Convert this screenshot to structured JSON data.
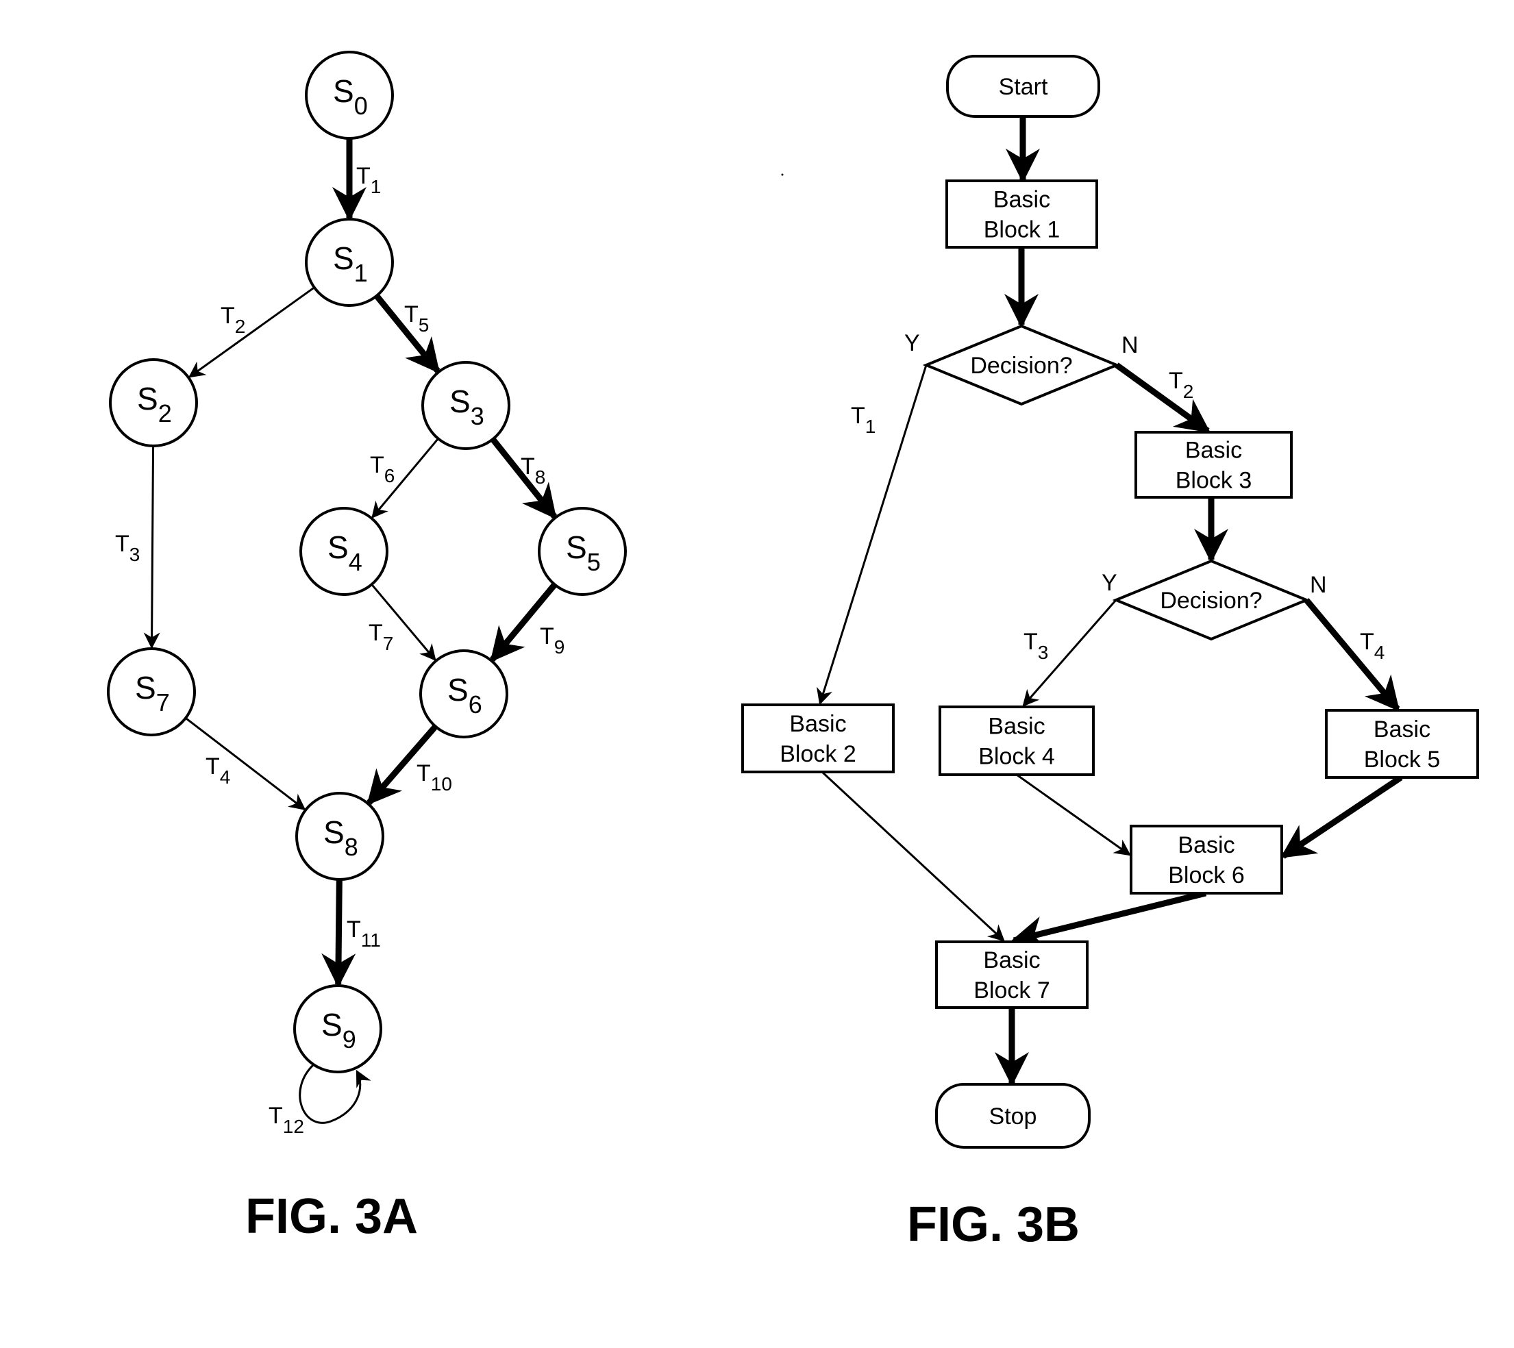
{
  "figures": [
    {
      "caption": "FIG. 3A",
      "type": "state-transition-graph",
      "states": [
        {
          "id": "S0",
          "letter": "S",
          "index": "0"
        },
        {
          "id": "S1",
          "letter": "S",
          "index": "1"
        },
        {
          "id": "S2",
          "letter": "S",
          "index": "2"
        },
        {
          "id": "S3",
          "letter": "S",
          "index": "3"
        },
        {
          "id": "S4",
          "letter": "S",
          "index": "4"
        },
        {
          "id": "S5",
          "letter": "S",
          "index": "5"
        },
        {
          "id": "S6",
          "letter": "S",
          "index": "6"
        },
        {
          "id": "S7",
          "letter": "S",
          "index": "7"
        },
        {
          "id": "S8",
          "letter": "S",
          "index": "8"
        },
        {
          "id": "S9",
          "letter": "S",
          "index": "9"
        }
      ],
      "transitions": [
        {
          "id": "T1",
          "letter": "T",
          "index": "1",
          "from": "S0",
          "to": "S1",
          "emphasis": "thick"
        },
        {
          "id": "T2",
          "letter": "T",
          "index": "2",
          "from": "S1",
          "to": "S2",
          "emphasis": "thin"
        },
        {
          "id": "T5",
          "letter": "T",
          "index": "5",
          "from": "S1",
          "to": "S3",
          "emphasis": "thick"
        },
        {
          "id": "T3",
          "letter": "T",
          "index": "3",
          "from": "S2",
          "to": "S7",
          "emphasis": "thin"
        },
        {
          "id": "T6",
          "letter": "T",
          "index": "6",
          "from": "S3",
          "to": "S4",
          "emphasis": "thin"
        },
        {
          "id": "T8",
          "letter": "T",
          "index": "8",
          "from": "S3",
          "to": "S5",
          "emphasis": "thick"
        },
        {
          "id": "T7",
          "letter": "T",
          "index": "7",
          "from": "S4",
          "to": "S6",
          "emphasis": "thin"
        },
        {
          "id": "T9",
          "letter": "T",
          "index": "9",
          "from": "S5",
          "to": "S6",
          "emphasis": "thick"
        },
        {
          "id": "T4",
          "letter": "T",
          "index": "4",
          "from": "S7",
          "to": "S8",
          "emphasis": "thin"
        },
        {
          "id": "T10",
          "letter": "T",
          "index": "10",
          "from": "S6",
          "to": "S8",
          "emphasis": "thick"
        },
        {
          "id": "T11",
          "letter": "T",
          "index": "11",
          "from": "S8",
          "to": "S9",
          "emphasis": "thick"
        },
        {
          "id": "T12",
          "letter": "T",
          "index": "12",
          "from": "S9",
          "to": "S9",
          "emphasis": "thin"
        }
      ]
    },
    {
      "caption": "FIG. 3B",
      "type": "flowchart",
      "nodes": [
        {
          "id": "start",
          "shape": "terminal",
          "lines": [
            "Start"
          ]
        },
        {
          "id": "bb1",
          "shape": "process",
          "lines": [
            "Basic",
            "Block 1"
          ]
        },
        {
          "id": "d1",
          "shape": "decision",
          "lines": [
            "Decision?"
          ]
        },
        {
          "id": "bb2",
          "shape": "process",
          "lines": [
            "Basic",
            "Block 2"
          ]
        },
        {
          "id": "bb3",
          "shape": "process",
          "lines": [
            "Basic",
            "Block 3"
          ]
        },
        {
          "id": "d2",
          "shape": "decision",
          "lines": [
            "Decision?"
          ]
        },
        {
          "id": "bb4",
          "shape": "process",
          "lines": [
            "Basic",
            "Block 4"
          ]
        },
        {
          "id": "bb5",
          "shape": "process",
          "lines": [
            "Basic",
            "Block 5"
          ]
        },
        {
          "id": "bb6",
          "shape": "process",
          "lines": [
            "Basic",
            "Block 6"
          ]
        },
        {
          "id": "bb7",
          "shape": "process",
          "lines": [
            "Basic",
            "Block 7"
          ]
        },
        {
          "id": "stop",
          "shape": "terminal",
          "lines": [
            "Stop"
          ]
        }
      ],
      "edges": [
        {
          "from": "start",
          "to": "bb1",
          "emphasis": "thick",
          "branch": "",
          "label": ""
        },
        {
          "from": "bb1",
          "to": "d1",
          "emphasis": "thick",
          "branch": "",
          "label": ""
        },
        {
          "from": "d1",
          "to": "bb2",
          "emphasis": "thin",
          "branch": "Y",
          "label_letter": "T",
          "label_index": "1"
        },
        {
          "from": "d1",
          "to": "bb3",
          "emphasis": "thick",
          "branch": "N",
          "label_letter": "T",
          "label_index": "2"
        },
        {
          "from": "bb3",
          "to": "d2",
          "emphasis": "thick",
          "branch": "",
          "label": ""
        },
        {
          "from": "d2",
          "to": "bb4",
          "emphasis": "thin",
          "branch": "Y",
          "label_letter": "T",
          "label_index": "3"
        },
        {
          "from": "d2",
          "to": "bb5",
          "emphasis": "thick",
          "branch": "N",
          "label_letter": "T",
          "label_index": "4"
        },
        {
          "from": "bb2",
          "to": "bb7",
          "emphasis": "thin",
          "branch": "",
          "label": ""
        },
        {
          "from": "bb4",
          "to": "bb6",
          "emphasis": "thin",
          "branch": "",
          "label": ""
        },
        {
          "from": "bb5",
          "to": "bb6",
          "emphasis": "thick",
          "branch": "",
          "label": ""
        },
        {
          "from": "bb6",
          "to": "bb7",
          "emphasis": "thick",
          "branch": "",
          "label": ""
        },
        {
          "from": "bb7",
          "to": "stop",
          "emphasis": "thick",
          "branch": "",
          "label": ""
        }
      ]
    }
  ]
}
